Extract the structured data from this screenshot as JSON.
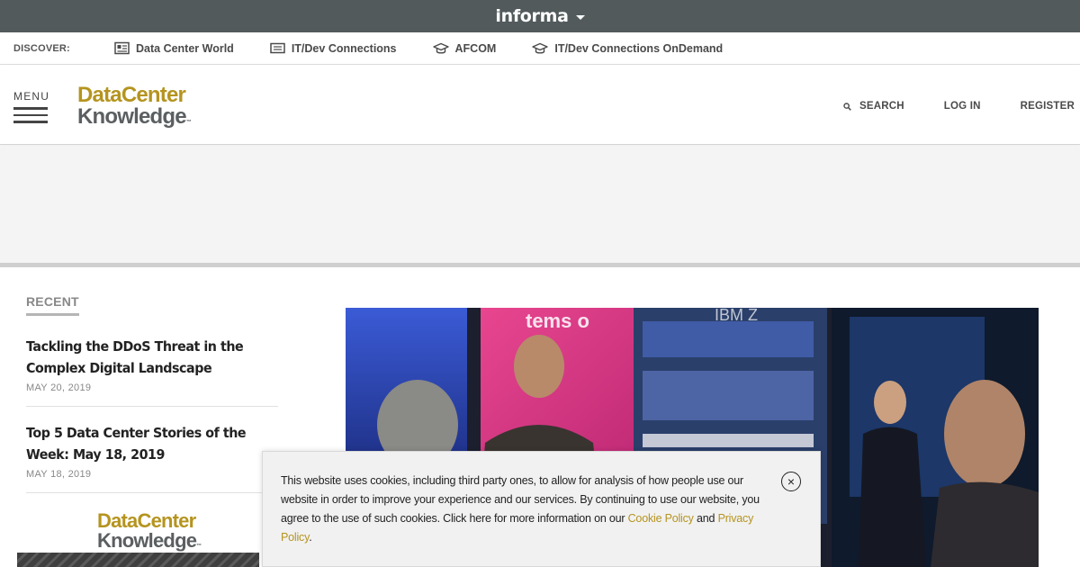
{
  "informa": {
    "logo_text": "informa"
  },
  "discover": {
    "label": "DISCOVER:",
    "links": [
      {
        "label": "Data Center World",
        "icon": "newspaper-icon"
      },
      {
        "label": "IT/Dev Connections",
        "icon": "ticket-icon"
      },
      {
        "label": "AFCOM",
        "icon": "graduation-cap-icon"
      },
      {
        "label": "IT/Dev Connections OnDemand",
        "icon": "graduation-cap-icon"
      }
    ]
  },
  "header": {
    "menu_label": "MENU",
    "logo_line1": "DataCenter",
    "logo_line2": "Knowledge",
    "logo_tm": "™",
    "search_label": "SEARCH",
    "login_label": "LOG IN",
    "register_label": "REGISTER"
  },
  "sidebar": {
    "heading": "RECENT",
    "items": [
      {
        "title": "Tackling the DDoS Threat in the Complex Digital Landscape",
        "date": "MAY 20, 2019"
      },
      {
        "title": "Top 5 Data Center Stories of the Week: May 18, 2019",
        "date": "MAY 18, 2019"
      }
    ],
    "promo_line1": "DataCenter",
    "promo_line2": "Knowledge",
    "promo_tm": "™"
  },
  "hero": {
    "sign_text": "tems o",
    "brand_text": "IBM Z"
  },
  "cookie": {
    "text_before": "This website uses cookies, including third party ones, to allow for analysis of how people use our website in order to improve your experience and our services. By continuing to use our website, you agree to the use of such cookies. Click here for more information on our ",
    "cookie_policy_link": "Cookie Policy",
    "text_and": " and ",
    "privacy_policy_link": "Privacy Policy",
    "text_end": ".",
    "close_symbol": "×"
  },
  "colors": {
    "informa_bar": "#525a5c",
    "brand_gold": "#b5941f",
    "brand_gray": "#5b5f61",
    "ad_band": "#f4f4f4"
  }
}
